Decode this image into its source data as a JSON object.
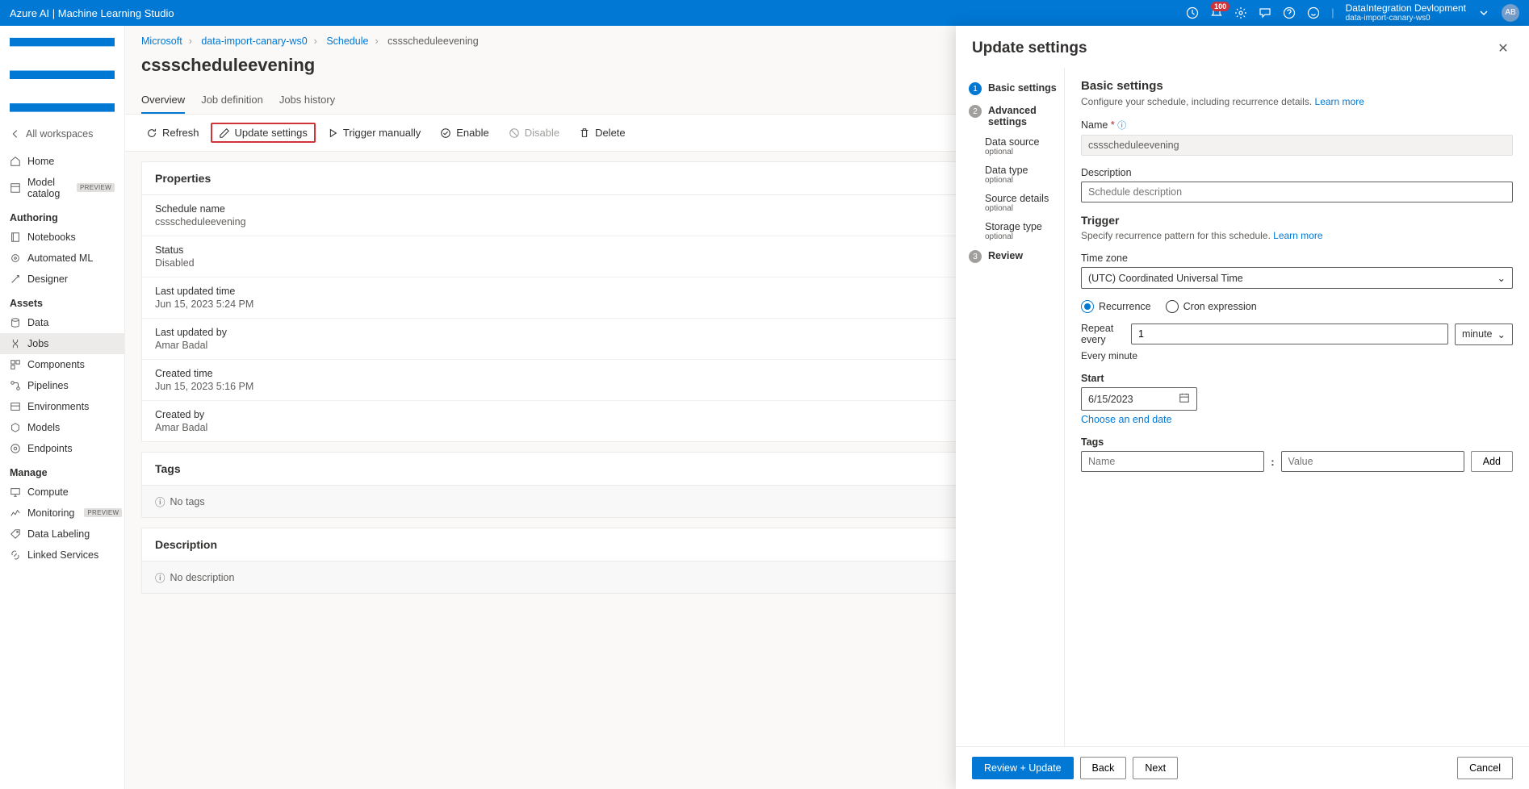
{
  "topbar": {
    "title": "Azure AI | Machine Learning Studio",
    "notifications_count": "100",
    "tenant_name": "DataIntegration Devlopment",
    "workspace": "data-import-canary-ws0",
    "avatar_initials": "AB"
  },
  "sidebar": {
    "back": "All workspaces",
    "home": "Home",
    "model_catalog": "Model catalog",
    "preview": "PREVIEW",
    "sections": {
      "authoring": "Authoring",
      "assets": "Assets",
      "manage": "Manage"
    },
    "authoring": {
      "notebooks": "Notebooks",
      "automl": "Automated ML",
      "designer": "Designer"
    },
    "assets": {
      "data": "Data",
      "jobs": "Jobs",
      "components": "Components",
      "pipelines": "Pipelines",
      "environments": "Environments",
      "models": "Models",
      "endpoints": "Endpoints"
    },
    "manage": {
      "compute": "Compute",
      "monitoring": "Monitoring",
      "data_labeling": "Data Labeling",
      "linked_services": "Linked Services"
    }
  },
  "breadcrumb": {
    "l1": "Microsoft",
    "l2": "data-import-canary-ws0",
    "l3": "Schedule",
    "l4": "cssscheduleevening"
  },
  "page": {
    "title": "cssscheduleevening"
  },
  "tabs": {
    "overview": "Overview",
    "job_def": "Job definition",
    "jobs_history": "Jobs history"
  },
  "toolbar": {
    "refresh": "Refresh",
    "update_settings": "Update settings",
    "trigger_manually": "Trigger manually",
    "enable": "Enable",
    "disable": "Disable",
    "delete": "Delete"
  },
  "properties": {
    "header": "Properties",
    "schedule_name": {
      "label": "Schedule name",
      "value": "cssscheduleevening"
    },
    "status": {
      "label": "Status",
      "value": "Disabled"
    },
    "last_updated_time": {
      "label": "Last updated time",
      "value": "Jun 15, 2023 5:24 PM"
    },
    "last_updated_by": {
      "label": "Last updated by",
      "value": "Amar Badal"
    },
    "created_time": {
      "label": "Created time",
      "value": "Jun 15, 2023 5:16 PM"
    },
    "created_by": {
      "label": "Created by",
      "value": "Amar Badal"
    }
  },
  "tags_card": {
    "header": "Tags",
    "empty": "No tags"
  },
  "desc_card": {
    "header": "Description",
    "empty": "No description"
  },
  "panel": {
    "title": "Update settings",
    "stepper": {
      "s1": "Basic settings",
      "s2": "Advanced settings",
      "s2a": "Data source",
      "s2b": "Data type",
      "s2c": "Source details",
      "s2d": "Storage type",
      "optional": "optional",
      "s3": "Review"
    },
    "form": {
      "heading": "Basic settings",
      "sub": "Configure your schedule, including recurrence details.",
      "learn_more": "Learn more",
      "name_label": "Name",
      "name_value": "cssscheduleevening",
      "desc_label": "Description",
      "desc_placeholder": "Schedule description",
      "trigger_heading": "Trigger",
      "trigger_sub": "Specify recurrence pattern for this schedule.",
      "tz_label": "Time zone",
      "tz_value": "(UTC) Coordinated Universal Time",
      "recurrence": "Recurrence",
      "cron": "Cron expression",
      "repeat_every": "Repeat every",
      "repeat_value": "1",
      "repeat_unit": "minute",
      "repeat_hint": "Every minute",
      "start_label": "Start",
      "start_value": "6/15/2023",
      "choose_end": "Choose an end date",
      "tags_label": "Tags",
      "tag_name_ph": "Name",
      "tag_value_ph": "Value",
      "add": "Add"
    },
    "footer": {
      "review_update": "Review + Update",
      "back": "Back",
      "next": "Next",
      "cancel": "Cancel"
    }
  }
}
